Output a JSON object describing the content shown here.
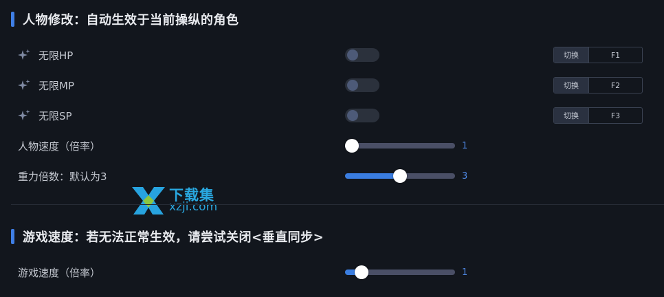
{
  "section1": {
    "title": "人物修改：自动生效于当前操纵的角色"
  },
  "toggles": [
    {
      "label": "无限HP",
      "hotkey_label": "切换",
      "hotkey": "F1",
      "on": false
    },
    {
      "label": "无限MP",
      "hotkey_label": "切换",
      "hotkey": "F2",
      "on": false
    },
    {
      "label": "无限SP",
      "hotkey_label": "切换",
      "hotkey": "F3",
      "on": false
    }
  ],
  "sliders": [
    {
      "label": "人物速度（倍率）",
      "value": "1",
      "level": 0.0
    },
    {
      "label": "重力倍数：默认为3",
      "value": "3",
      "level": 0.5
    }
  ],
  "section2": {
    "title": "游戏速度：若无法正常生效，请尝试关闭<垂直同步>"
  },
  "sliders2": [
    {
      "label": "游戏速度（倍率）",
      "value": "1",
      "level": 0.1
    }
  ],
  "watermark": {
    "line1": "下载集",
    "line2": "xzji.com"
  },
  "colors": {
    "accent": "#3f7fe6",
    "background": "#12161d",
    "slider_fill": "#3a7de0",
    "value_text": "#4d86e0"
  },
  "icons": {
    "cheat_item": "sparkle-icon"
  }
}
